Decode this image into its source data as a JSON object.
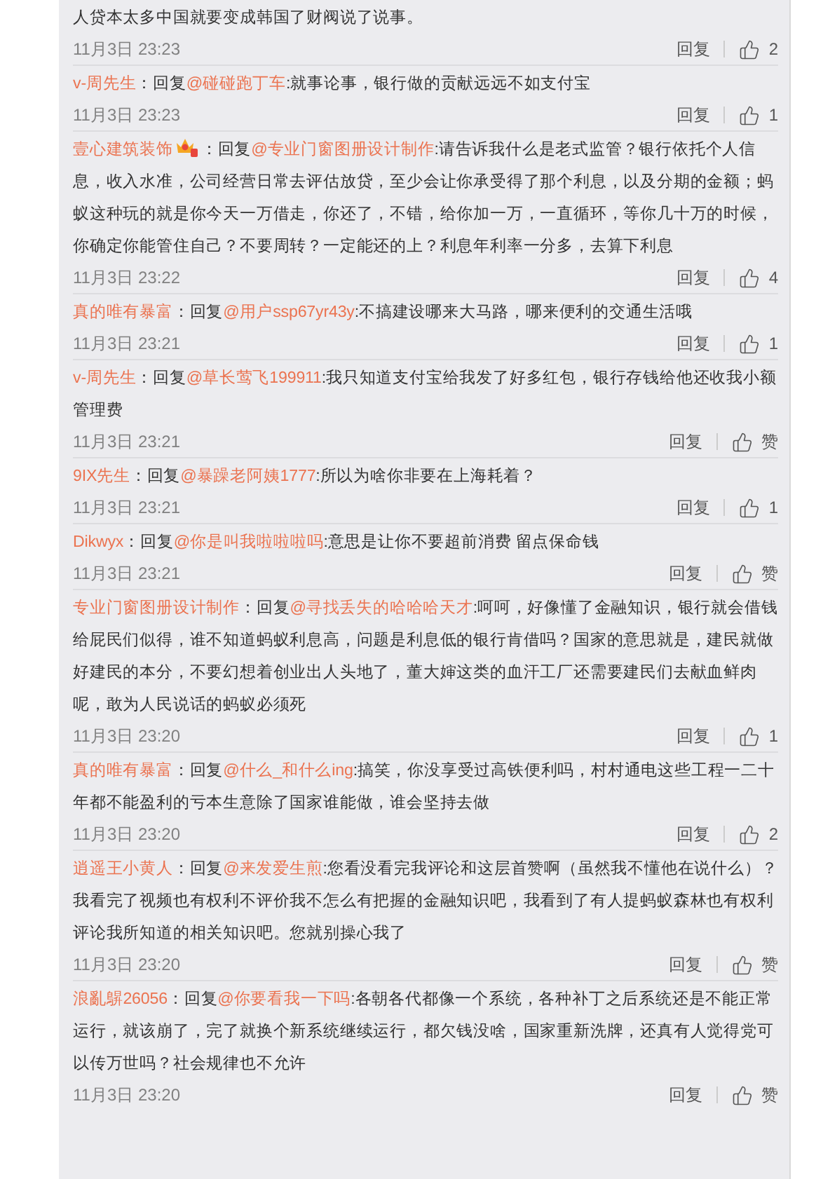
{
  "comments": [
    {
      "text": "人贷本太多中国就要变成韩国了财阀说了说事。",
      "time": "11月3日 23:23",
      "reply": "回复",
      "like": "2",
      "badge": false
    },
    {
      "author": "v-周先生",
      "prefix": "：回复",
      "mention": "@碰碰跑丁车",
      "text": ":就事论事，银行做的贡献远远不如支付宝",
      "time": "11月3日 23:23",
      "reply": "回复",
      "like": "1",
      "badge": false
    },
    {
      "author": "壹心建筑装饰",
      "prefix": "：回复",
      "mention": "@专业门窗图册设计制作",
      "text": ":请告诉我什么是老式监管？银行依托个人信息，收入水准，公司经营日常去评估放贷，至少会让你承受得了那个利息，以及分期的金额；蚂蚁这种玩的就是你今天一万借走，你还了，不错，给你加一万，一直循环，等你几十万的时候，你确定你能管住自己？不要周转？一定能还的上？利息年利率一分多，去算下利息",
      "time": "11月3日 23:22",
      "reply": "回复",
      "like": "4",
      "badge": true
    },
    {
      "author": "真的唯有暴富",
      "prefix": "：回复",
      "mention": "@用户ssp67yr43y",
      "text": ":不搞建设哪来大马路，哪来便利的交通生活哦",
      "time": "11月3日 23:21",
      "reply": "回复",
      "like": "1",
      "badge": false
    },
    {
      "author": "v-周先生",
      "prefix": "：回复",
      "mention": "@草长莺飞199911",
      "text": ":我只知道支付宝给我发了好多红包，银行存钱给他还收我小额管理费",
      "time": "11月3日 23:21",
      "reply": "回复",
      "like": "赞",
      "badge": false
    },
    {
      "author": "9IX先生",
      "prefix": "：回复",
      "mention": "@暴躁老阿姨1777",
      "text": ":所以为啥你非要在上海耗着？",
      "time": "11月3日 23:21",
      "reply": "回复",
      "like": "1",
      "badge": false
    },
    {
      "author": "Dikwyx",
      "prefix": "：回复",
      "mention": "@你是叫我啦啦啦吗",
      "text": ":意思是让你不要超前消费 留点保命钱",
      "time": "11月3日 23:21",
      "reply": "回复",
      "like": "赞",
      "badge": false
    },
    {
      "author": "专业门窗图册设计制作",
      "prefix": "：回复",
      "mention": "@寻找丢失的哈哈哈天才",
      "text": ":呵呵，好像懂了金融知识，银行就会借钱给屁民们似得，谁不知道蚂蚁利息高，问题是利息低的银行肯借吗？国家的意思就是，建民就做好建民的本分，不要幻想着创业出人头地了，董大婶这类的血汗工厂还需要建民们去献血鲜肉呢，敢为人民说话的蚂蚁必须死",
      "time": "11月3日 23:20",
      "reply": "回复",
      "like": "1",
      "badge": false
    },
    {
      "author": "真的唯有暴富",
      "prefix": "：回复",
      "mention": "@什么_和什么ing",
      "text": ":搞笑，你没享受过高铁便利吗，村村通电这些工程一二十年都不能盈利的亏本生意除了国家谁能做，谁会坚持去做",
      "time": "11月3日 23:20",
      "reply": "回复",
      "like": "2",
      "badge": false
    },
    {
      "author": "逍遥王小黄人",
      "prefix": "：回复",
      "mention": "@来发爱生煎",
      "text": ":您看没看完我评论和这层首赞啊（虽然我不懂他在说什么）？我看完了视频也有权利不评价我不怎么有把握的金融知识吧，我看到了有人提蚂蚁森林也有权利评论我所知道的相关知识吧。您就别操心我了",
      "time": "11月3日 23:20",
      "reply": "回复",
      "like": "赞",
      "badge": false
    },
    {
      "author": "浪亂鵿26056",
      "prefix": "：回复",
      "mention": "@你要看我一下吗",
      "text": ":各朝各代都像一个系统，各种补丁之后系统还是不能正常运行，就该崩了，完了就换个新系统继续运行，都欠钱没啥，国家重新洗牌，还真有人觉得党可以传万世吗？社会规律也不允许",
      "time": "11月3日 23:20",
      "reply": "回复",
      "like": "赞",
      "badge": false
    }
  ]
}
